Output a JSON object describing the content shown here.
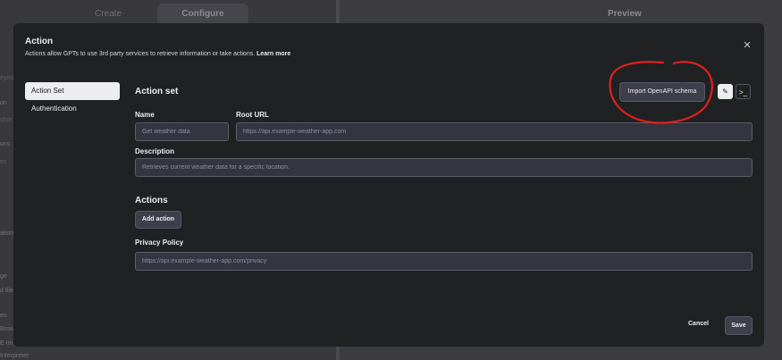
{
  "background": {
    "tabs": [
      "Create",
      "Configure"
    ],
    "active_tab": "Configure",
    "preview_label": "Preview",
    "side_fragments": [
      "eyou",
      "on",
      "shor",
      "ons",
      "es",
      "ation",
      "ge",
      "d file",
      "es",
      "Brow",
      "E Im",
      "Interpreter"
    ]
  },
  "modal": {
    "title": "Action",
    "subtitle": "Actions allow GPTs to use 3rd party services to retrieve information or take actions.",
    "learn_more": "Learn more",
    "close_glyph": "✕"
  },
  "nav": {
    "items": [
      {
        "label": "Action Set"
      },
      {
        "label": "Authentication"
      }
    ]
  },
  "action_set": {
    "title": "Action set",
    "import_label": "Import OpenAPI schema",
    "edit_icon": "✎",
    "terminal_icon": ">_",
    "name_label": "Name",
    "name_placeholder": "Get weather data",
    "root_url_label": "Root URL",
    "root_url_placeholder": "https://api.example-weather-app.com",
    "description_label": "Description",
    "description_placeholder": "Retrieves current weather data for a specific location.",
    "actions_title": "Actions",
    "add_action_label": "Add action",
    "privacy_label": "Privacy Policy",
    "privacy_placeholder": "https://api.example-weather-app.com/privacy"
  },
  "footer": {
    "cancel_label": "Cancel",
    "save_label": "Save"
  },
  "colors": {
    "annotation": "#e0201e",
    "modal_bg": "#202123",
    "input_bg": "#343541"
  }
}
